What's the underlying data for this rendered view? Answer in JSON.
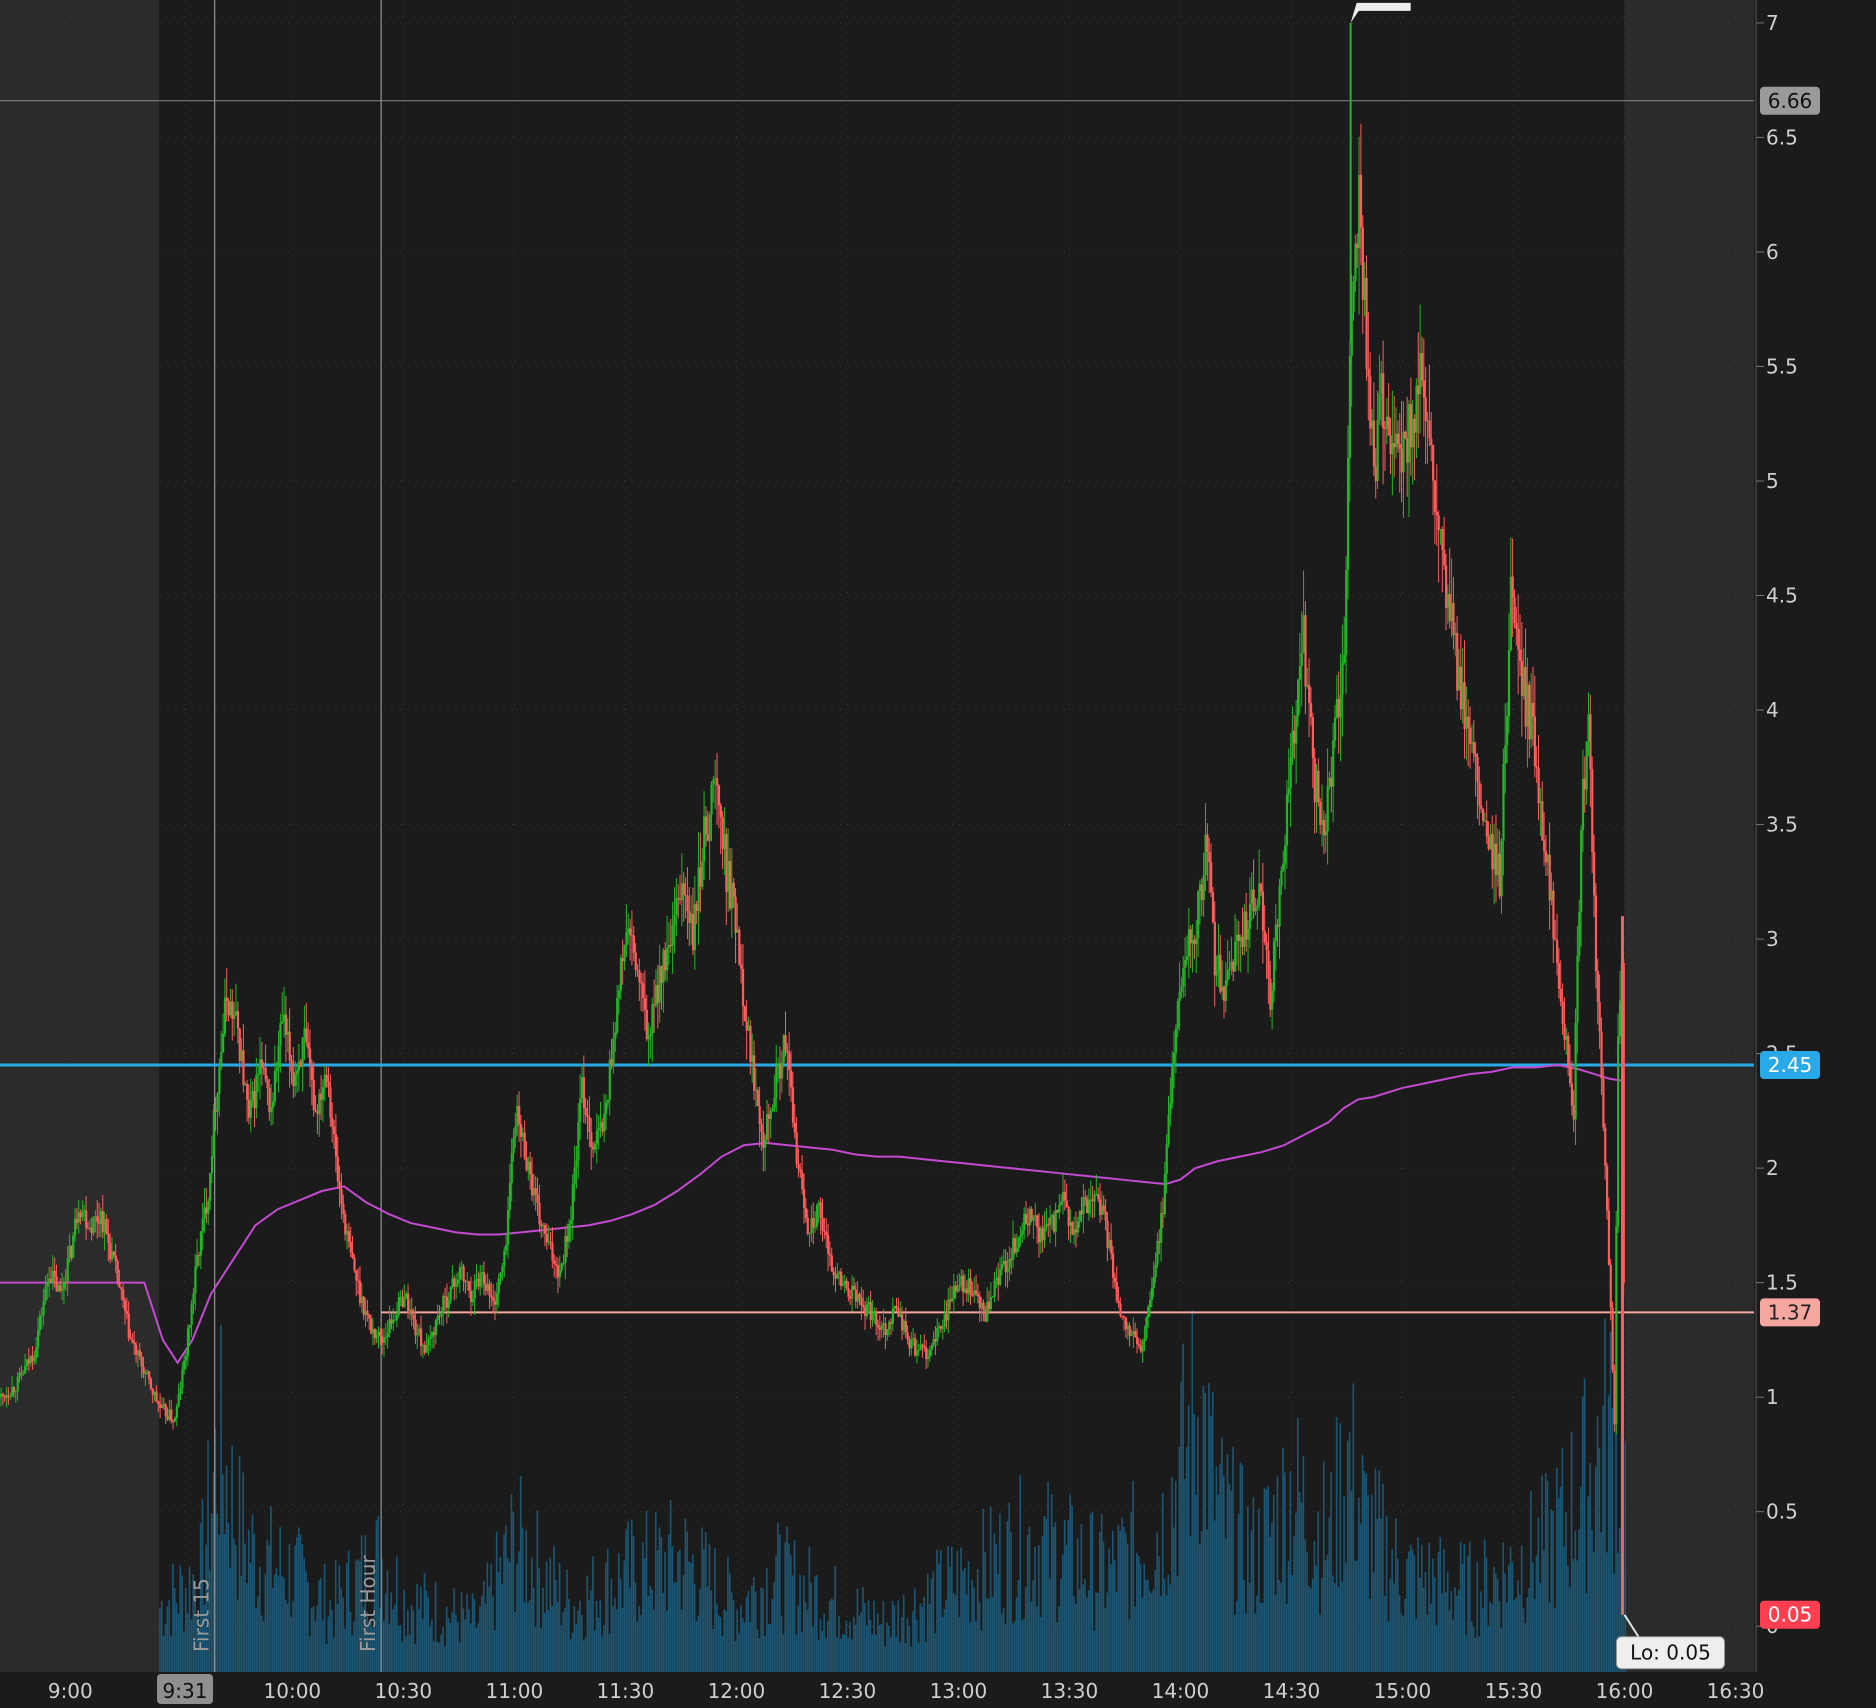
{
  "chart_data": {
    "type": "candlestick",
    "title": "",
    "xlabel": "",
    "ylabel": "",
    "ylim": [
      -0.2,
      7.1
    ],
    "grid": true,
    "x_ticks": [
      "9:00",
      "9:31",
      "10:00",
      "10:30",
      "11:00",
      "11:30",
      "12:00",
      "12:30",
      "13:00",
      "13:30",
      "14:00",
      "14:30",
      "15:00",
      "15:30",
      "16:00",
      "16:30"
    ],
    "x_tick_minutes": [
      540,
      571,
      600,
      630,
      660,
      690,
      720,
      750,
      780,
      810,
      840,
      870,
      900,
      930,
      960,
      990
    ],
    "x_range_minutes": [
      521,
      995
    ],
    "y_ticks": [
      "0",
      "0.5",
      "1",
      "1.5",
      "2",
      "2.5",
      "3",
      "3.5",
      "4",
      "4.5",
      "5",
      "5.5",
      "6",
      "6.5",
      "7"
    ],
    "y_tick_values": [
      0,
      0.5,
      1,
      1.5,
      2,
      2.5,
      3,
      3.5,
      4,
      4.5,
      5,
      5.5,
      6,
      6.5,
      7
    ],
    "session": {
      "open_minute": 564,
      "close_minute": 960
    },
    "markers": [
      {
        "label": "First 15",
        "minute": 579
      },
      {
        "label": "First Hour",
        "minute": 624
      }
    ],
    "price_lines": [
      {
        "value": 2.45,
        "label": "2.45",
        "color": "#29a9e8"
      },
      {
        "value": 1.37,
        "label": "1.37",
        "color": "#f5a79f"
      }
    ],
    "crosshair": {
      "value": 6.66,
      "label": "6.66",
      "time_label": "9:31"
    },
    "last_price": {
      "value": 0.05,
      "label": "0.05",
      "color": "#ff3f4f"
    },
    "low_marker": {
      "label": "Lo: 0.05",
      "minute": 960,
      "value": 0.05
    },
    "series": [
      {
        "name": "",
        "kind": "candles",
        "points_minute_price": [
          [
            521,
            1.0
          ],
          [
            525,
            1.05
          ],
          [
            530,
            1.2
          ],
          [
            534,
            1.55
          ],
          [
            537,
            1.45
          ],
          [
            540,
            1.65
          ],
          [
            542,
            1.85
          ],
          [
            545,
            1.75
          ],
          [
            548,
            1.8
          ],
          [
            552,
            1.55
          ],
          [
            556,
            1.25
          ],
          [
            560,
            1.1
          ],
          [
            564,
            0.95
          ],
          [
            568,
            0.9
          ],
          [
            571,
            1.2
          ],
          [
            574,
            1.6
          ],
          [
            577,
            1.9
          ],
          [
            579,
            2.3
          ],
          [
            582,
            2.75
          ],
          [
            585,
            2.6
          ],
          [
            588,
            2.2
          ],
          [
            591,
            2.45
          ],
          [
            594,
            2.25
          ],
          [
            597,
            2.65
          ],
          [
            600,
            2.4
          ],
          [
            603,
            2.55
          ],
          [
            606,
            2.25
          ],
          [
            609,
            2.45
          ],
          [
            612,
            1.95
          ],
          [
            615,
            1.65
          ],
          [
            618,
            1.45
          ],
          [
            621,
            1.3
          ],
          [
            624,
            1.25
          ],
          [
            627,
            1.35
          ],
          [
            630,
            1.45
          ],
          [
            633,
            1.3
          ],
          [
            636,
            1.2
          ],
          [
            639,
            1.35
          ],
          [
            642,
            1.45
          ],
          [
            645,
            1.55
          ],
          [
            648,
            1.45
          ],
          [
            651,
            1.55
          ],
          [
            654,
            1.4
          ],
          [
            657,
            1.6
          ],
          [
            660,
            2.25
          ],
          [
            663,
            2.05
          ],
          [
            666,
            1.8
          ],
          [
            669,
            1.65
          ],
          [
            672,
            1.55
          ],
          [
            675,
            1.8
          ],
          [
            678,
            2.35
          ],
          [
            681,
            2.1
          ],
          [
            684,
            2.2
          ],
          [
            687,
            2.65
          ],
          [
            690,
            3.05
          ],
          [
            693,
            2.85
          ],
          [
            696,
            2.55
          ],
          [
            699,
            2.85
          ],
          [
            702,
            2.95
          ],
          [
            705,
            3.25
          ],
          [
            708,
            3.0
          ],
          [
            711,
            3.45
          ],
          [
            714,
            3.7
          ],
          [
            717,
            3.3
          ],
          [
            720,
            3.05
          ],
          [
            722,
            2.7
          ],
          [
            724,
            2.45
          ],
          [
            727,
            2.15
          ],
          [
            730,
            2.35
          ],
          [
            733,
            2.55
          ],
          [
            736,
            2.05
          ],
          [
            739,
            1.75
          ],
          [
            742,
            1.8
          ],
          [
            745,
            1.6
          ],
          [
            748,
            1.5
          ],
          [
            751,
            1.45
          ],
          [
            754,
            1.4
          ],
          [
            757,
            1.35
          ],
          [
            760,
            1.3
          ],
          [
            763,
            1.4
          ],
          [
            766,
            1.25
          ],
          [
            769,
            1.2
          ],
          [
            772,
            1.2
          ],
          [
            775,
            1.3
          ],
          [
            778,
            1.45
          ],
          [
            781,
            1.5
          ],
          [
            784,
            1.45
          ],
          [
            787,
            1.35
          ],
          [
            790,
            1.5
          ],
          [
            793,
            1.6
          ],
          [
            796,
            1.7
          ],
          [
            799,
            1.8
          ],
          [
            802,
            1.7
          ],
          [
            805,
            1.75
          ],
          [
            808,
            1.85
          ],
          [
            811,
            1.7
          ],
          [
            814,
            1.85
          ],
          [
            817,
            1.9
          ],
          [
            820,
            1.7
          ],
          [
            823,
            1.4
          ],
          [
            826,
            1.3
          ],
          [
            829,
            1.2
          ],
          [
            832,
            1.45
          ],
          [
            835,
            1.85
          ],
          [
            838,
            2.55
          ],
          [
            841,
            2.95
          ],
          [
            844,
            3.05
          ],
          [
            847,
            3.45
          ],
          [
            849,
            2.9
          ],
          [
            852,
            2.75
          ],
          [
            855,
            3.0
          ],
          [
            858,
            3.1
          ],
          [
            861,
            3.2
          ],
          [
            864,
            2.75
          ],
          [
            867,
            3.3
          ],
          [
            870,
            3.85
          ],
          [
            873,
            4.3
          ],
          [
            876,
            3.7
          ],
          [
            878,
            3.45
          ],
          [
            881,
            3.8
          ],
          [
            884,
            4.2
          ],
          [
            886,
            5.8
          ],
          [
            888,
            6.3
          ],
          [
            890,
            5.6
          ],
          [
            892,
            5.0
          ],
          [
            894,
            5.35
          ],
          [
            897,
            5.2
          ],
          [
            899,
            5.05
          ],
          [
            902,
            5.25
          ],
          [
            905,
            5.45
          ],
          [
            908,
            4.95
          ],
          [
            911,
            4.55
          ],
          [
            914,
            4.25
          ],
          [
            917,
            3.9
          ],
          [
            920,
            3.65
          ],
          [
            923,
            3.4
          ],
          [
            926,
            3.25
          ],
          [
            929,
            4.5
          ],
          [
            932,
            4.1
          ],
          [
            935,
            3.9
          ],
          [
            938,
            3.45
          ],
          [
            941,
            3.0
          ],
          [
            944,
            2.55
          ],
          [
            946,
            2.25
          ],
          [
            948,
            3.5
          ],
          [
            950,
            3.9
          ],
          [
            952,
            2.9
          ],
          [
            955,
            1.85
          ],
          [
            957,
            0.9
          ],
          [
            958,
            2.5
          ],
          [
            959,
            2.9
          ],
          [
            960,
            0.05
          ]
        ]
      },
      {
        "name": "",
        "kind": "vwap",
        "color": "#c24bd1",
        "points_minute_price": [
          [
            521,
            1.5
          ],
          [
            545,
            1.5
          ],
          [
            560,
            1.5
          ],
          [
            565,
            1.25
          ],
          [
            569,
            1.15
          ],
          [
            573,
            1.25
          ],
          [
            578,
            1.45
          ],
          [
            584,
            1.6
          ],
          [
            590,
            1.75
          ],
          [
            596,
            1.82
          ],
          [
            602,
            1.86
          ],
          [
            608,
            1.9
          ],
          [
            614,
            1.92
          ],
          [
            620,
            1.85
          ],
          [
            626,
            1.8
          ],
          [
            632,
            1.76
          ],
          [
            638,
            1.74
          ],
          [
            644,
            1.72
          ],
          [
            650,
            1.71
          ],
          [
            656,
            1.71
          ],
          [
            662,
            1.72
          ],
          [
            668,
            1.73
          ],
          [
            674,
            1.74
          ],
          [
            680,
            1.75
          ],
          [
            686,
            1.77
          ],
          [
            692,
            1.8
          ],
          [
            698,
            1.84
          ],
          [
            704,
            1.9
          ],
          [
            710,
            1.97
          ],
          [
            716,
            2.05
          ],
          [
            722,
            2.1
          ],
          [
            728,
            2.11
          ],
          [
            734,
            2.1
          ],
          [
            740,
            2.09
          ],
          [
            746,
            2.08
          ],
          [
            752,
            2.06
          ],
          [
            758,
            2.05
          ],
          [
            764,
            2.05
          ],
          [
            770,
            2.04
          ],
          [
            776,
            2.03
          ],
          [
            782,
            2.02
          ],
          [
            788,
            2.01
          ],
          [
            794,
            2.0
          ],
          [
            800,
            1.99
          ],
          [
            806,
            1.98
          ],
          [
            812,
            1.97
          ],
          [
            818,
            1.96
          ],
          [
            824,
            1.95
          ],
          [
            830,
            1.94
          ],
          [
            836,
            1.93
          ],
          [
            840,
            1.95
          ],
          [
            844,
            2.0
          ],
          [
            850,
            2.03
          ],
          [
            856,
            2.05
          ],
          [
            862,
            2.07
          ],
          [
            868,
            2.1
          ],
          [
            874,
            2.15
          ],
          [
            880,
            2.2
          ],
          [
            884,
            2.26
          ],
          [
            888,
            2.3
          ],
          [
            892,
            2.31
          ],
          [
            896,
            2.33
          ],
          [
            900,
            2.35
          ],
          [
            906,
            2.37
          ],
          [
            912,
            2.39
          ],
          [
            918,
            2.41
          ],
          [
            924,
            2.42
          ],
          [
            930,
            2.44
          ],
          [
            936,
            2.44
          ],
          [
            942,
            2.45
          ],
          [
            948,
            2.43
          ],
          [
            952,
            2.41
          ],
          [
            956,
            2.39
          ],
          [
            960,
            2.38
          ]
        ]
      },
      {
        "name": "",
        "kind": "volume",
        "color": "#1c5673",
        "points_minute_volume": [
          [
            564,
            0.2
          ],
          [
            570,
            0.25
          ],
          [
            575,
            0.3
          ],
          [
            580,
            0.7
          ],
          [
            585,
            0.45
          ],
          [
            590,
            0.35
          ],
          [
            600,
            0.3
          ],
          [
            610,
            0.2
          ],
          [
            624,
            0.35
          ],
          [
            630,
            0.22
          ],
          [
            650,
            0.15
          ],
          [
            660,
            0.4
          ],
          [
            675,
            0.2
          ],
          [
            690,
            0.3
          ],
          [
            705,
            0.35
          ],
          [
            720,
            0.2
          ],
          [
            730,
            0.3
          ],
          [
            745,
            0.22
          ],
          [
            760,
            0.15
          ],
          [
            780,
            0.28
          ],
          [
            800,
            0.4
          ],
          [
            820,
            0.3
          ],
          [
            835,
            0.45
          ],
          [
            845,
            0.82
          ],
          [
            850,
            0.5
          ],
          [
            860,
            0.35
          ],
          [
            870,
            0.55
          ],
          [
            880,
            0.4
          ],
          [
            885,
            0.65
          ],
          [
            890,
            0.45
          ],
          [
            900,
            0.3
          ],
          [
            920,
            0.25
          ],
          [
            940,
            0.4
          ],
          [
            950,
            0.6
          ],
          [
            956,
            0.75
          ],
          [
            960,
            0.55
          ]
        ]
      }
    ]
  }
}
